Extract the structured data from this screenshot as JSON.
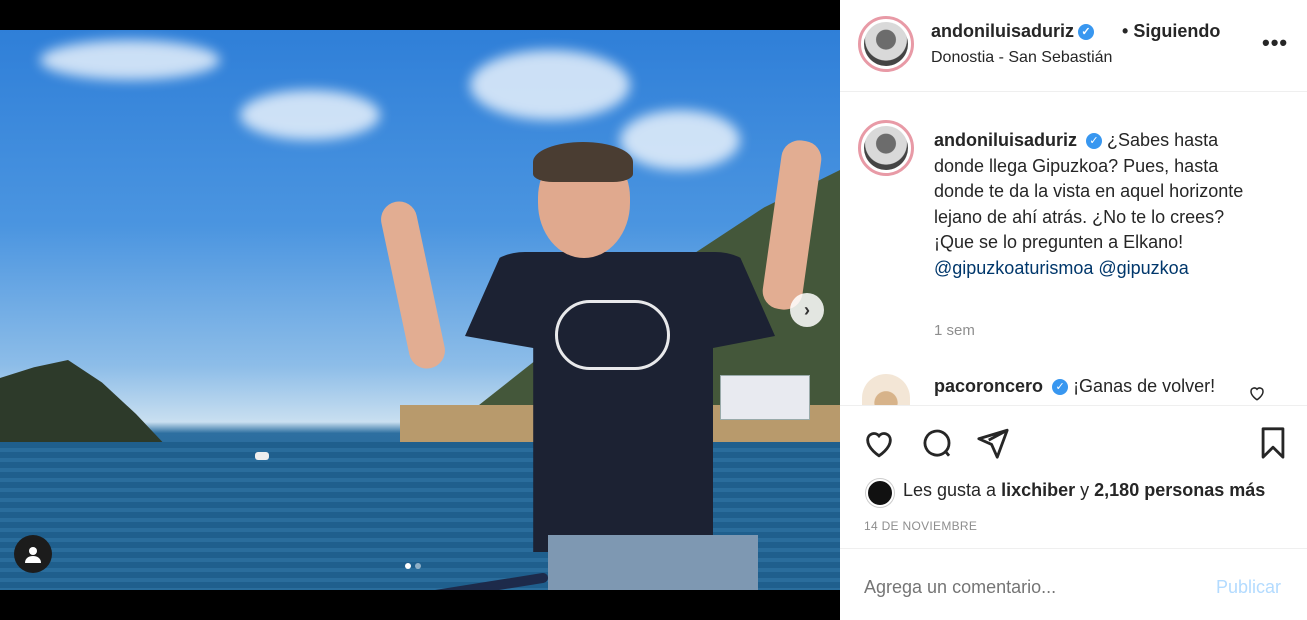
{
  "header": {
    "username": "andoniluisaduriz",
    "separator": "•",
    "follow_status": "Siguiendo",
    "location": "Donostia - San Sebastián",
    "more_label": "•••"
  },
  "caption": {
    "username": "andoniluisaduriz",
    "text": "¿Sabes hasta donde llega Gipuzkoa? Pues, hasta donde te da la vista en aquel horizonte lejano de ahí atrás. ¿No te lo crees? ¡Que se lo pregunten a Elkano!",
    "mention1": "@gipuzkoaturismoa",
    "mention2": "@gipuzkoa",
    "time": "1 sem"
  },
  "comment": {
    "username": "pacoroncero",
    "text": "¡Ganas de volver!"
  },
  "likes": {
    "prefix": "Les gusta a",
    "user": "lixchiber",
    "connector": "y",
    "count_text": "2,180 personas más"
  },
  "date": "14 DE NOVIEMBRE",
  "comment_input": {
    "placeholder": "Agrega un comentario...",
    "post_label": "Publicar"
  },
  "media": {
    "next_label": "›",
    "carousel_dots": 2,
    "active_dot": 1
  },
  "colors": {
    "verified": "#3897f0",
    "mention": "#00376b",
    "post_button": "#b3dbff",
    "avatar_ring": "#e89aa6"
  }
}
